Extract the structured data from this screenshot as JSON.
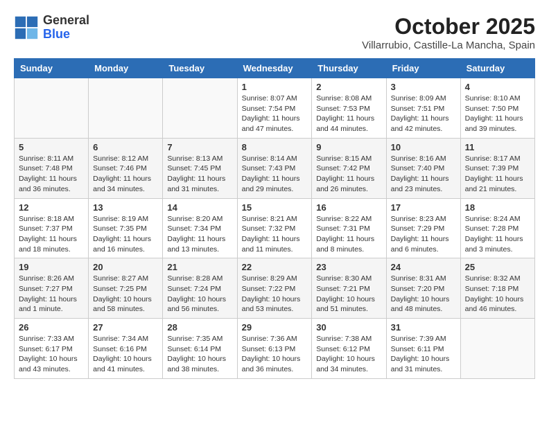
{
  "header": {
    "logo_general": "General",
    "logo_blue": "Blue",
    "month_year": "October 2025",
    "location": "Villarrubio, Castille-La Mancha, Spain"
  },
  "weekdays": [
    "Sunday",
    "Monday",
    "Tuesday",
    "Wednesday",
    "Thursday",
    "Friday",
    "Saturday"
  ],
  "weeks": [
    [
      {
        "day": "",
        "info": ""
      },
      {
        "day": "",
        "info": ""
      },
      {
        "day": "",
        "info": ""
      },
      {
        "day": "1",
        "info": "Sunrise: 8:07 AM\nSunset: 7:54 PM\nDaylight: 11 hours and 47 minutes."
      },
      {
        "day": "2",
        "info": "Sunrise: 8:08 AM\nSunset: 7:53 PM\nDaylight: 11 hours and 44 minutes."
      },
      {
        "day": "3",
        "info": "Sunrise: 8:09 AM\nSunset: 7:51 PM\nDaylight: 11 hours and 42 minutes."
      },
      {
        "day": "4",
        "info": "Sunrise: 8:10 AM\nSunset: 7:50 PM\nDaylight: 11 hours and 39 minutes."
      }
    ],
    [
      {
        "day": "5",
        "info": "Sunrise: 8:11 AM\nSunset: 7:48 PM\nDaylight: 11 hours and 36 minutes."
      },
      {
        "day": "6",
        "info": "Sunrise: 8:12 AM\nSunset: 7:46 PM\nDaylight: 11 hours and 34 minutes."
      },
      {
        "day": "7",
        "info": "Sunrise: 8:13 AM\nSunset: 7:45 PM\nDaylight: 11 hours and 31 minutes."
      },
      {
        "day": "8",
        "info": "Sunrise: 8:14 AM\nSunset: 7:43 PM\nDaylight: 11 hours and 29 minutes."
      },
      {
        "day": "9",
        "info": "Sunrise: 8:15 AM\nSunset: 7:42 PM\nDaylight: 11 hours and 26 minutes."
      },
      {
        "day": "10",
        "info": "Sunrise: 8:16 AM\nSunset: 7:40 PM\nDaylight: 11 hours and 23 minutes."
      },
      {
        "day": "11",
        "info": "Sunrise: 8:17 AM\nSunset: 7:39 PM\nDaylight: 11 hours and 21 minutes."
      }
    ],
    [
      {
        "day": "12",
        "info": "Sunrise: 8:18 AM\nSunset: 7:37 PM\nDaylight: 11 hours and 18 minutes."
      },
      {
        "day": "13",
        "info": "Sunrise: 8:19 AM\nSunset: 7:35 PM\nDaylight: 11 hours and 16 minutes."
      },
      {
        "day": "14",
        "info": "Sunrise: 8:20 AM\nSunset: 7:34 PM\nDaylight: 11 hours and 13 minutes."
      },
      {
        "day": "15",
        "info": "Sunrise: 8:21 AM\nSunset: 7:32 PM\nDaylight: 11 hours and 11 minutes."
      },
      {
        "day": "16",
        "info": "Sunrise: 8:22 AM\nSunset: 7:31 PM\nDaylight: 11 hours and 8 minutes."
      },
      {
        "day": "17",
        "info": "Sunrise: 8:23 AM\nSunset: 7:29 PM\nDaylight: 11 hours and 6 minutes."
      },
      {
        "day": "18",
        "info": "Sunrise: 8:24 AM\nSunset: 7:28 PM\nDaylight: 11 hours and 3 minutes."
      }
    ],
    [
      {
        "day": "19",
        "info": "Sunrise: 8:26 AM\nSunset: 7:27 PM\nDaylight: 11 hours and 1 minute."
      },
      {
        "day": "20",
        "info": "Sunrise: 8:27 AM\nSunset: 7:25 PM\nDaylight: 10 hours and 58 minutes."
      },
      {
        "day": "21",
        "info": "Sunrise: 8:28 AM\nSunset: 7:24 PM\nDaylight: 10 hours and 56 minutes."
      },
      {
        "day": "22",
        "info": "Sunrise: 8:29 AM\nSunset: 7:22 PM\nDaylight: 10 hours and 53 minutes."
      },
      {
        "day": "23",
        "info": "Sunrise: 8:30 AM\nSunset: 7:21 PM\nDaylight: 10 hours and 51 minutes."
      },
      {
        "day": "24",
        "info": "Sunrise: 8:31 AM\nSunset: 7:20 PM\nDaylight: 10 hours and 48 minutes."
      },
      {
        "day": "25",
        "info": "Sunrise: 8:32 AM\nSunset: 7:18 PM\nDaylight: 10 hours and 46 minutes."
      }
    ],
    [
      {
        "day": "26",
        "info": "Sunrise: 7:33 AM\nSunset: 6:17 PM\nDaylight: 10 hours and 43 minutes."
      },
      {
        "day": "27",
        "info": "Sunrise: 7:34 AM\nSunset: 6:16 PM\nDaylight: 10 hours and 41 minutes."
      },
      {
        "day": "28",
        "info": "Sunrise: 7:35 AM\nSunset: 6:14 PM\nDaylight: 10 hours and 38 minutes."
      },
      {
        "day": "29",
        "info": "Sunrise: 7:36 AM\nSunset: 6:13 PM\nDaylight: 10 hours and 36 minutes."
      },
      {
        "day": "30",
        "info": "Sunrise: 7:38 AM\nSunset: 6:12 PM\nDaylight: 10 hours and 34 minutes."
      },
      {
        "day": "31",
        "info": "Sunrise: 7:39 AM\nSunset: 6:11 PM\nDaylight: 10 hours and 31 minutes."
      },
      {
        "day": "",
        "info": ""
      }
    ]
  ]
}
